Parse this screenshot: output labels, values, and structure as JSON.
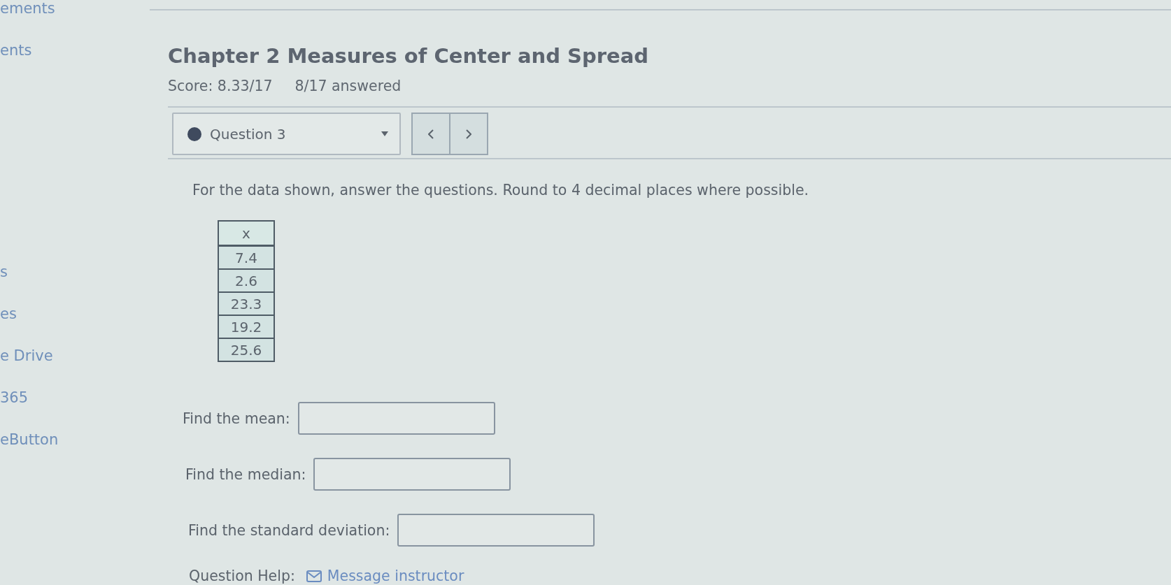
{
  "sidebar": {
    "groups": [
      {
        "items": [
          "ements",
          "ents"
        ]
      },
      {
        "items": [
          "s",
          "es",
          "e Drive",
          "365",
          "eButton"
        ]
      }
    ]
  },
  "assignment": {
    "title": "Chapter 2 Measures of Center and Spread",
    "score": "Score: 8.33/17",
    "answered": "8/17 answered"
  },
  "question_nav": {
    "question": "Question 3"
  },
  "question": {
    "prompt": "For the data shown, answer the questions. Round to 4 decimal places where possible.",
    "table": {
      "columns": [
        "x"
      ],
      "rows": [
        [
          "7.4"
        ],
        [
          "2.6"
        ],
        [
          "23.3"
        ],
        [
          "19.2"
        ],
        [
          "25.6"
        ]
      ]
    },
    "answers": [
      {
        "label": "Find the mean:"
      },
      {
        "label": "Find the median:"
      },
      {
        "label": "Find the standard deviation:"
      }
    ]
  },
  "help": {
    "label": "Question Help:",
    "links": [
      {
        "kind": "message",
        "label": "Message instructor"
      }
    ]
  }
}
